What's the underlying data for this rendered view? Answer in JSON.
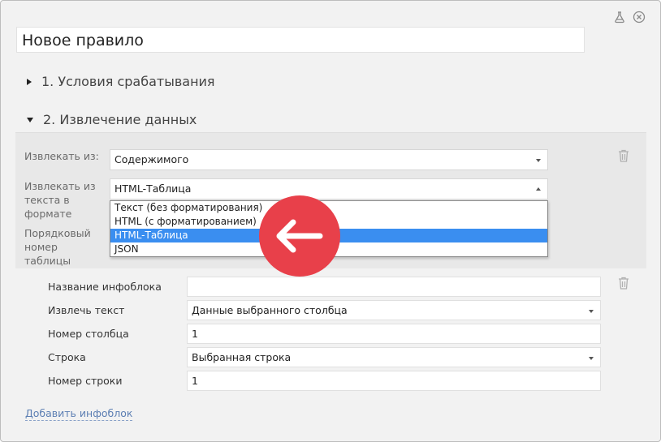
{
  "window": {
    "rule_name": "Новое правило"
  },
  "sections": {
    "conditions_title": "1. Условия срабатывания",
    "extraction_title": "2. Извлечение данных"
  },
  "extract": {
    "from_label": "Извлекать из:",
    "from_value": "Содержимого",
    "format_label": "Извлекать из текста в формате",
    "format_value": "HTML-Таблица",
    "table_number_label": "Порядковый номер таблицы",
    "format_options": [
      "Текст (без форматирования)",
      "HTML (с форматированием)",
      "HTML-Таблица",
      "JSON"
    ],
    "selected_option": "HTML-Таблица"
  },
  "infoblock": {
    "name_label": "Название инфоблока",
    "name_value": "",
    "extract_text_label": "Извлечь текст",
    "extract_text_value": "Данные выбранного столбца",
    "column_number_label": "Номер столбца",
    "column_number_value": "1",
    "row_label": "Строка",
    "row_value": "Выбранная строка",
    "row_number_label": "Номер строки",
    "row_number_value": "1"
  },
  "add_infoblock_link": "Добавить инфоблок",
  "colors": {
    "accent_red": "#e8404a",
    "selection_blue": "#3a8ef0",
    "link_blue": "#5d7fb3"
  },
  "icons": [
    "flask-icon",
    "close-circle-icon",
    "trash-icon",
    "arrow-left-icon"
  ]
}
